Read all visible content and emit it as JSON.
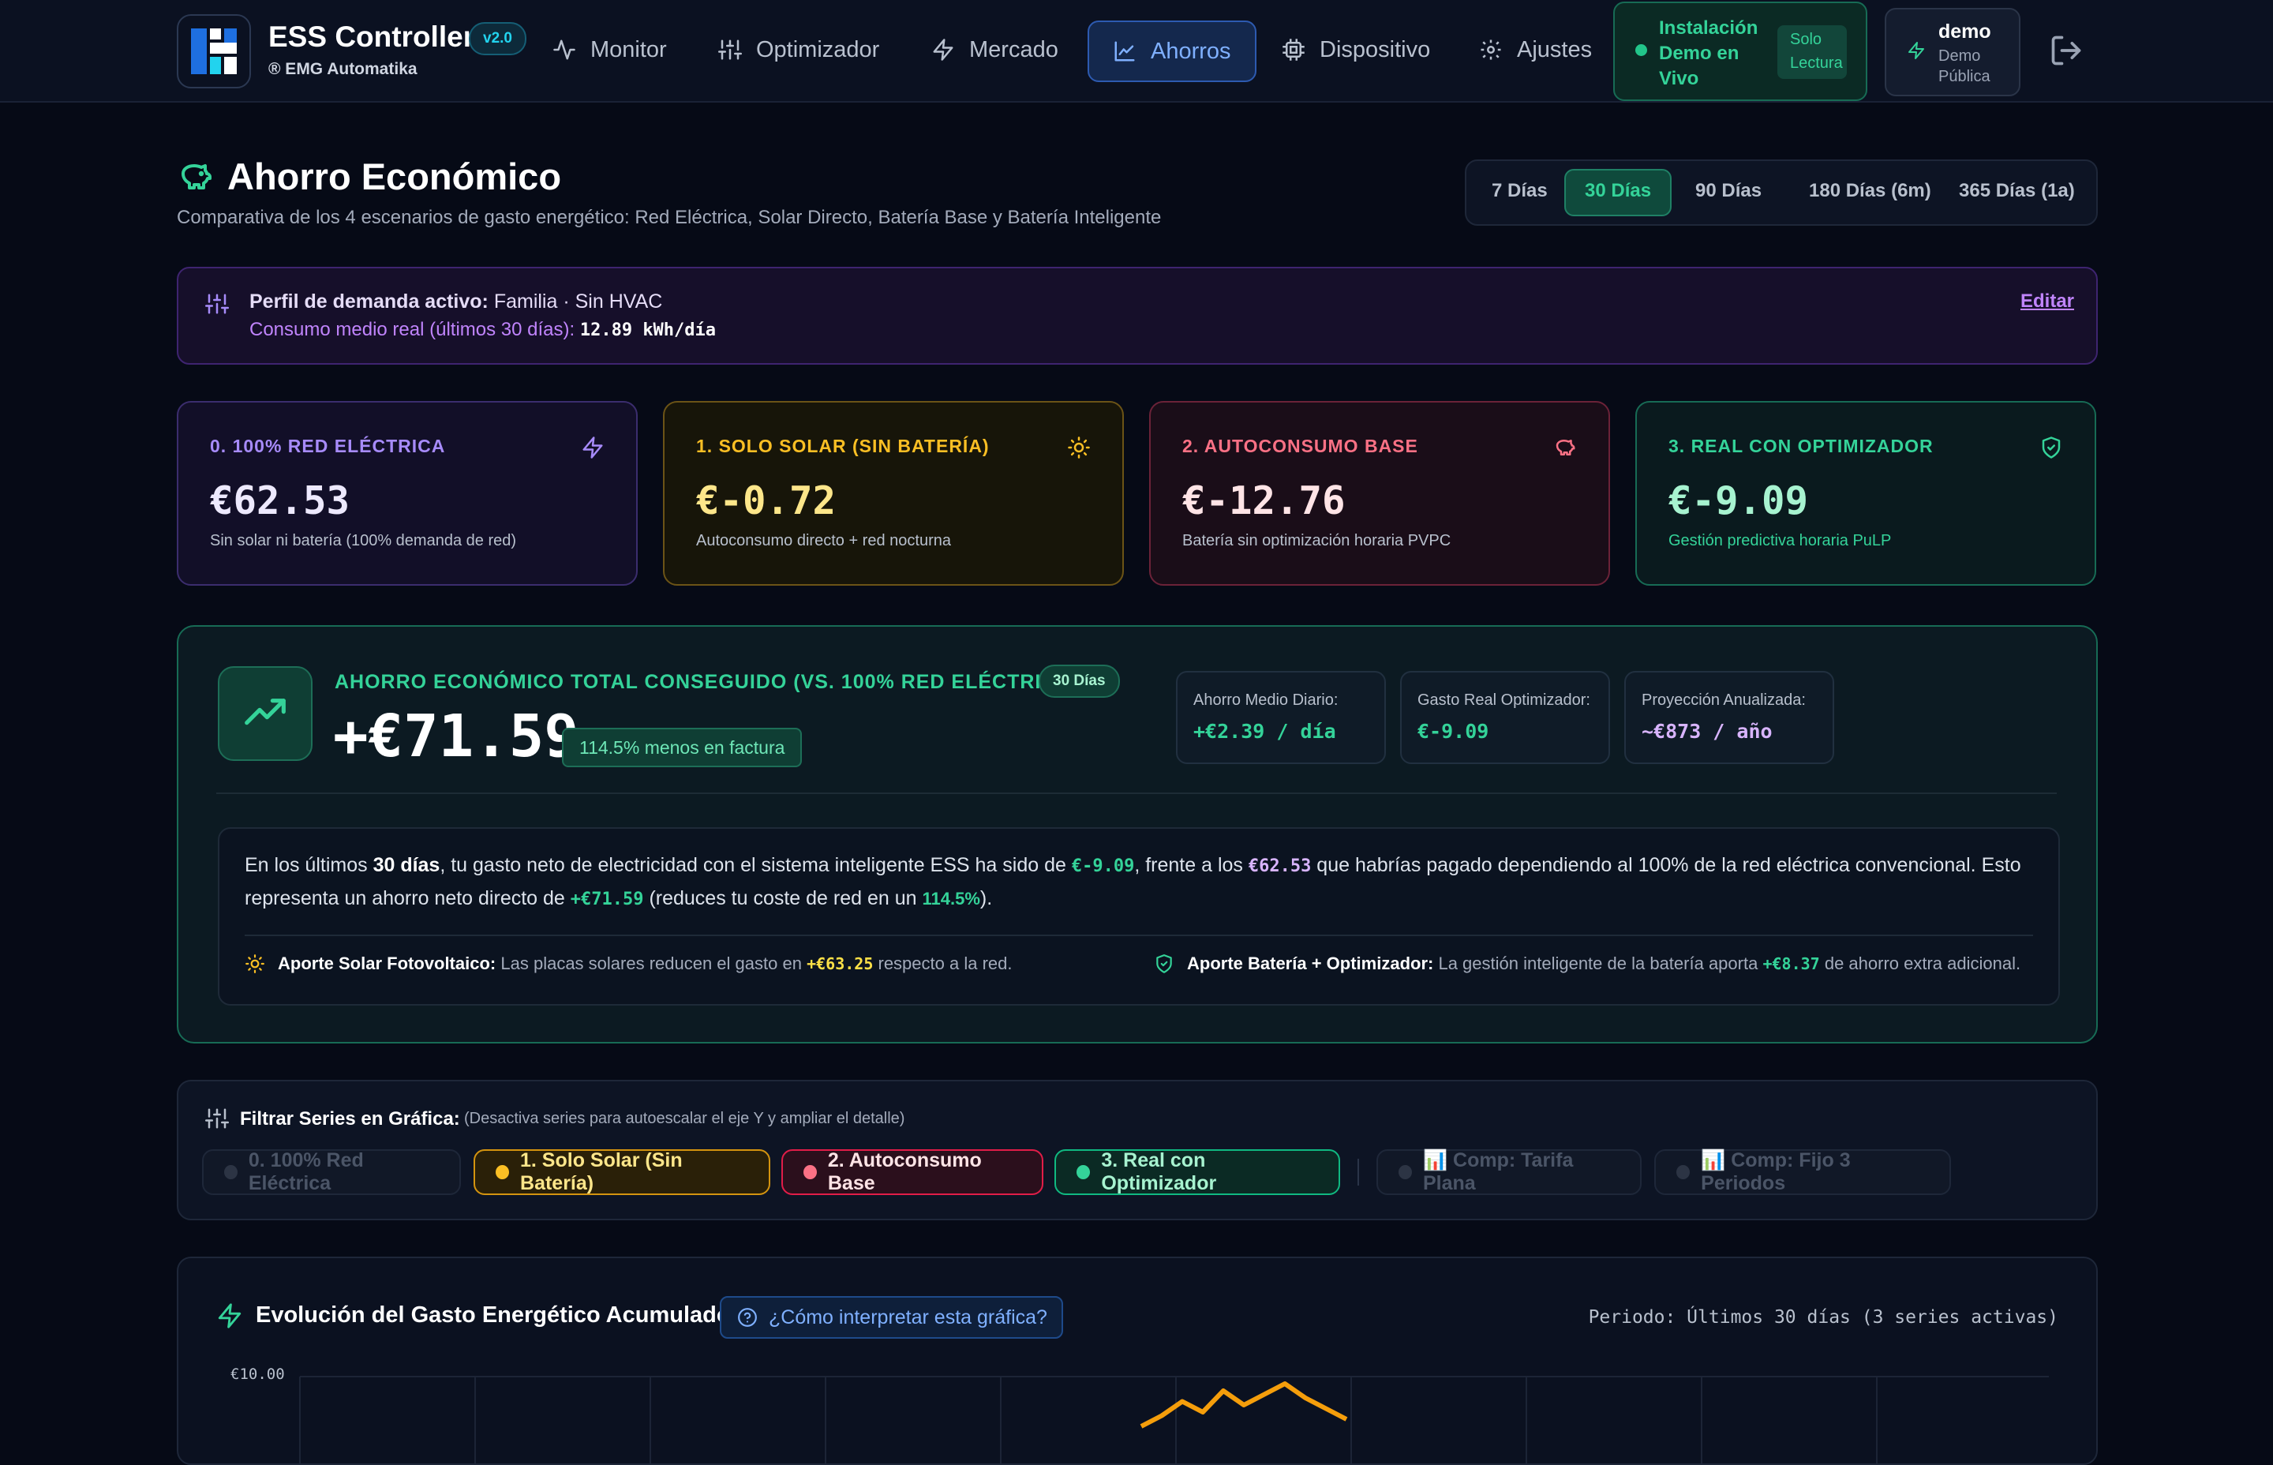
{
  "header": {
    "brand_name": "ESS Controller",
    "brand_sub": "® EMG Automatika",
    "version": "v2.0",
    "nav": [
      {
        "label": "Monitor",
        "icon": "activity-icon"
      },
      {
        "label": "Optimizador",
        "icon": "sliders-icon"
      },
      {
        "label": "Mercado",
        "icon": "zap-icon"
      },
      {
        "label": "Ahorros",
        "icon": "chart-line-icon",
        "active": true
      },
      {
        "label": "Dispositivo",
        "icon": "cpu-icon"
      },
      {
        "label": "Ajustes",
        "icon": "gear-icon"
      }
    ],
    "status": {
      "label": "Instalación Demo en Vivo",
      "badge": "Solo Lectura"
    },
    "user": {
      "name": "demo",
      "role": "Demo Pública"
    }
  },
  "page": {
    "title": "Ahorro Económico",
    "subtitle": "Comparativa de los 4 escenarios de gasto energético: Red Eléctrica, Solar Directo, Batería Base y Batería Inteligente",
    "periods": [
      "7 Días",
      "30 Días",
      "90 Días",
      "180 Días (6m)",
      "365 Días (1a)"
    ],
    "active_period": "30 Días"
  },
  "profile": {
    "label": "Perfil de demanda activo:",
    "value": "Familia · Sin HVAC",
    "consumo_label": "Consumo medio real (últimos 30 días):",
    "consumo_value": "12.89 kWh/día",
    "edit": "Editar"
  },
  "scenarios": [
    {
      "label": "0. 100% RED ELÉCTRICA",
      "value": "€62.53",
      "desc": "Sin solar ni batería (100% demanda de red)",
      "icon": "zap-icon",
      "color": "#a78bfa"
    },
    {
      "label": "1. SOLO SOLAR (SIN BATERÍA)",
      "value": "€-0.72",
      "desc": "Autoconsumo directo + red nocturna",
      "icon": "sun-icon",
      "color": "#fbbf24"
    },
    {
      "label": "2. AUTOCONSUMO BASE",
      "value": "€-12.76",
      "desc": "Batería sin optimización horaria PVPC",
      "icon": "piggy-bank-icon",
      "color": "#fb7185"
    },
    {
      "label": "3. REAL CON OPTIMIZADOR",
      "value": "€-9.09",
      "desc": "Gestión predictiva horaria PuLP",
      "icon": "shield-check-icon",
      "color": "#34d399"
    }
  ],
  "savings": {
    "label": "AHORRO ECONÓMICO TOTAL CONSEGUIDO (VS. 100% RED ELÉCTRICA)",
    "badge": "30 Días",
    "value": "+€71.59",
    "pct": "114.5% menos en factura",
    "metrics": [
      {
        "label": "Ahorro Medio Diario:",
        "value": "+€2.39 / día",
        "color": "#34d399"
      },
      {
        "label": "Gasto Real Optimizador:",
        "value": "€-9.09",
        "color": "#34d399"
      },
      {
        "label": "Proyección Anualizada:",
        "value": "~€873 / año",
        "color": "#d8b4fe"
      }
    ],
    "text": {
      "t1": "En los últimos ",
      "days": "30 días",
      "t2": ", tu gasto neto de electricidad con el sistema inteligente ESS ha sido de ",
      "real": "€-9.09",
      "t3": ", frente a los ",
      "grid": "€62.53",
      "t4": " que habrías pagado dependiendo al 100% de la red eléctrica convencional. Esto representa un ahorro neto directo de ",
      "saving": "+€71.59",
      "t5": " (reduces tu coste de red en un ",
      "pct": "114.5%",
      "t6": ")."
    },
    "solar": {
      "label": "Aporte Solar Fotovoltaico:",
      "t1": "Las placas solares reducen el gasto en",
      "value": "+€63.25",
      "t2": "respecto a la red."
    },
    "battery": {
      "label": "Aporte Batería + Optimizador:",
      "t1": "La gestión inteligente de la batería aporta",
      "value": "+€8.37",
      "t2": "de ahorro extra adicional."
    }
  },
  "filter": {
    "title": "Filtrar Series en Gráfica:",
    "hint": "(Desactiva series para autoescalar el eje Y y ampliar el detalle)",
    "chips": [
      {
        "label": "0. 100% Red Eléctrica",
        "on": false
      },
      {
        "label": "1. Solo Solar (Sin Batería)",
        "on": true,
        "color": "#fbbf24"
      },
      {
        "label": "2. Autoconsumo Base",
        "on": true,
        "color": "#fb7185"
      },
      {
        "label": "3. Real con Optimizador",
        "on": true,
        "color": "#34d399"
      },
      {
        "label": "📊 Comp: Tarifa Plana",
        "on": false
      },
      {
        "label": "📊 Comp: Fijo 3 Periodos",
        "on": false
      }
    ]
  },
  "chart": {
    "title": "Evolución del Gasto Energético Acumulado",
    "help": "¿Cómo interpretar esta gráfica?",
    "period": "Periodo: Últimos 30 días (3 series activas)"
  },
  "chart_data": {
    "type": "line",
    "title": "Evolución del Gasto Energético Acumulado",
    "y_tick_labels": [
      "€10.00"
    ],
    "series": [
      {
        "name": "1. Solo Solar (Sin Batería)",
        "color": "#f59e0b",
        "visible_values": [
          8.6,
          8.9,
          9.3,
          9.0,
          9.6,
          9.2,
          9.5,
          9.8,
          9.4,
          9.1,
          8.8
        ]
      }
    ],
    "grid": true
  }
}
